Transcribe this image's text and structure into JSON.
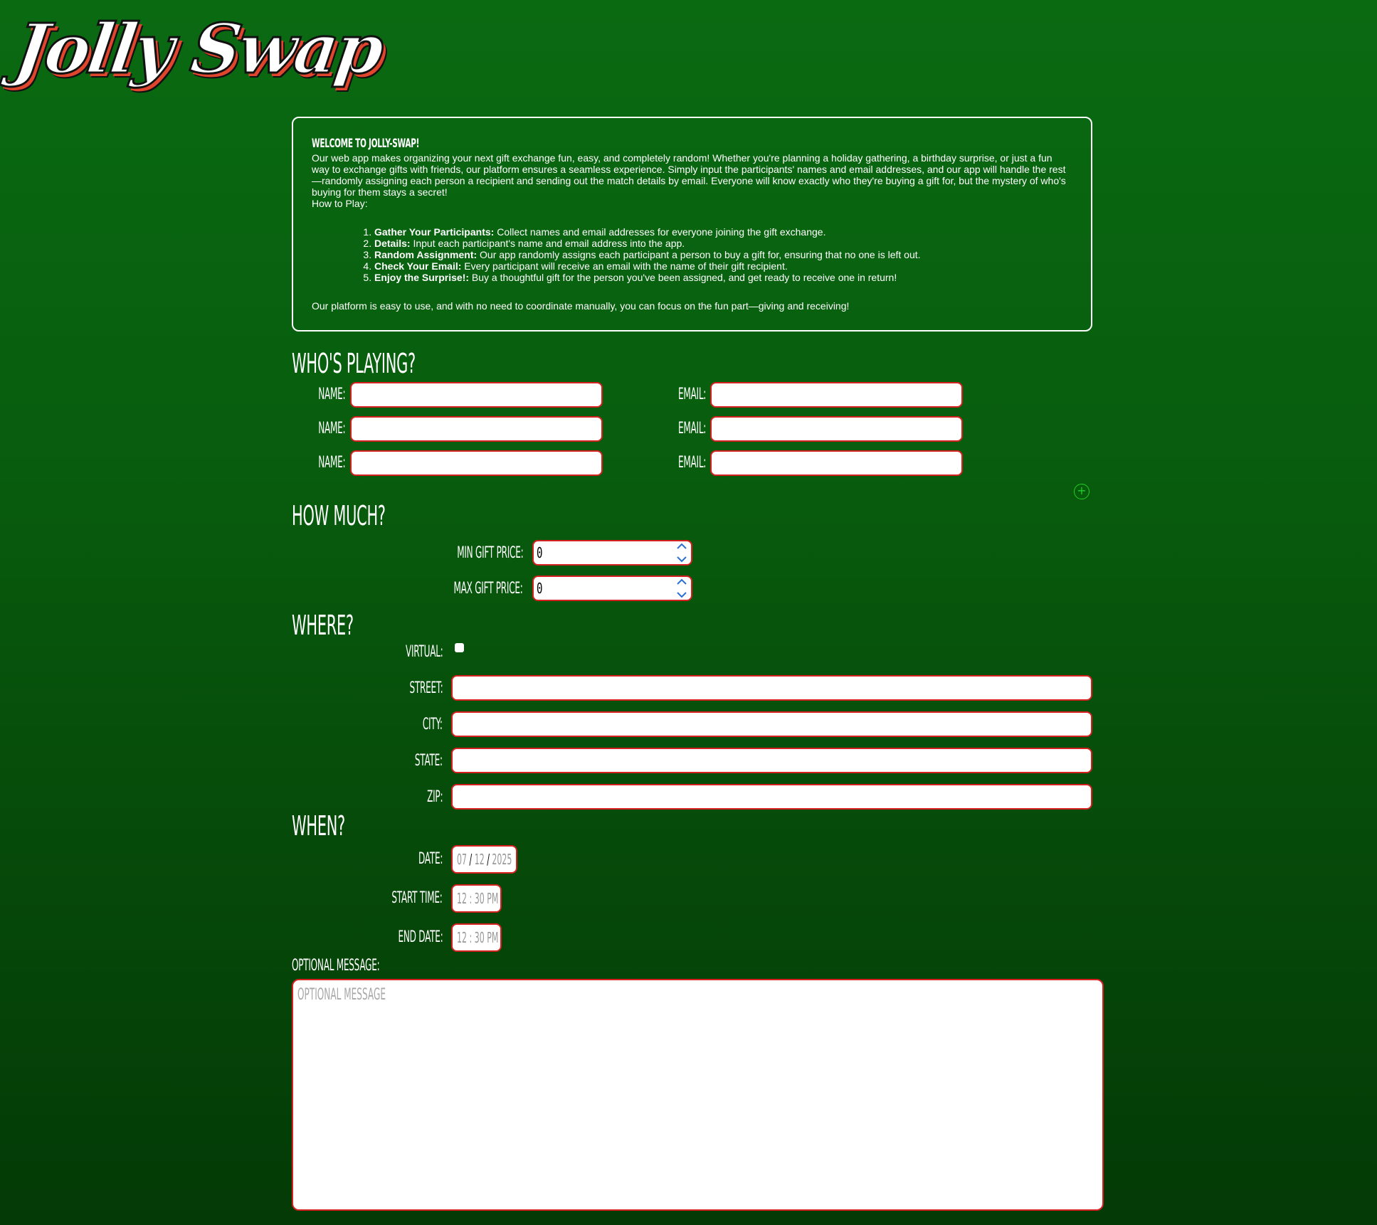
{
  "app": {
    "logo": "Jolly Swap"
  },
  "intro": {
    "title": "Welcome to Jolly-Swap!",
    "paragraph": "Our web app makes organizing your next gift exchange fun, easy, and completely random! Whether you're planning a holiday gathering, a birthday surprise, or just a fun way to exchange gifts with friends, our platform ensures a seamless experience. Simply input the participants' names and email addresses, and our app will handle the rest—randomly assigning each person a recipient and sending out the match details by email. Everyone will know exactly who they're buying a gift for, but the mystery of who's buying for them stays a secret!",
    "how_to_play": "How to Play:",
    "steps": [
      {
        "bold": "Gather Your Participants:",
        "text": " Collect names and email addresses for everyone joining the gift exchange."
      },
      {
        "bold": "Details:",
        "text": " Input each participant's name and email address into the app."
      },
      {
        "bold": "Random Assignment:",
        "text": " Our app randomly assigns each participant a person to buy a gift for, ensuring that no one is left out."
      },
      {
        "bold": "Check Your Email:",
        "text": " Every participant will receive an email with the name of their gift recipient."
      },
      {
        "bold": "Enjoy the Surprise!:",
        "text": " Buy a thoughtful gift for the person you've been assigned, and get ready to receive one in return!"
      }
    ],
    "closing": "Our platform is easy to use, and with no need to coordinate manually, you can focus on the fun part—giving and receiving!"
  },
  "players": {
    "title": "Who's Playing?",
    "name_label": "Name:",
    "email_label": "Email:",
    "rows": [
      {
        "name": "",
        "email": ""
      },
      {
        "name": "",
        "email": ""
      },
      {
        "name": "",
        "email": ""
      }
    ],
    "add_icon": "plus-circle-icon",
    "add_glyph": "+"
  },
  "price": {
    "title": "How Much?",
    "min_label": "Min Gift Price:",
    "min_value": "0",
    "max_label": "Max Gift Price:",
    "max_value": "0"
  },
  "where": {
    "title": "Where?",
    "virtual_label": "Virtual:",
    "virtual_checked": false,
    "street_label": "Street:",
    "city_label": "City:",
    "state_label": "State:",
    "zip_label": "Zip:"
  },
  "when": {
    "title": "When?",
    "date_label": "Date:",
    "date_month": "07",
    "date_day": "12",
    "date_year": "2025",
    "start_label": "Start Time:",
    "start_value": "12 : 30 PM",
    "end_label": "End Date:",
    "end_value": "12 : 30 PM"
  },
  "message": {
    "label": "Optional Message:",
    "placeholder": "Optional Message"
  },
  "colors": {
    "background_top": "#0a6a12",
    "background_bottom": "#043a06",
    "input_border": "#d62020",
    "add_button": "#20d020",
    "logo_shadow": "#e0452e"
  }
}
